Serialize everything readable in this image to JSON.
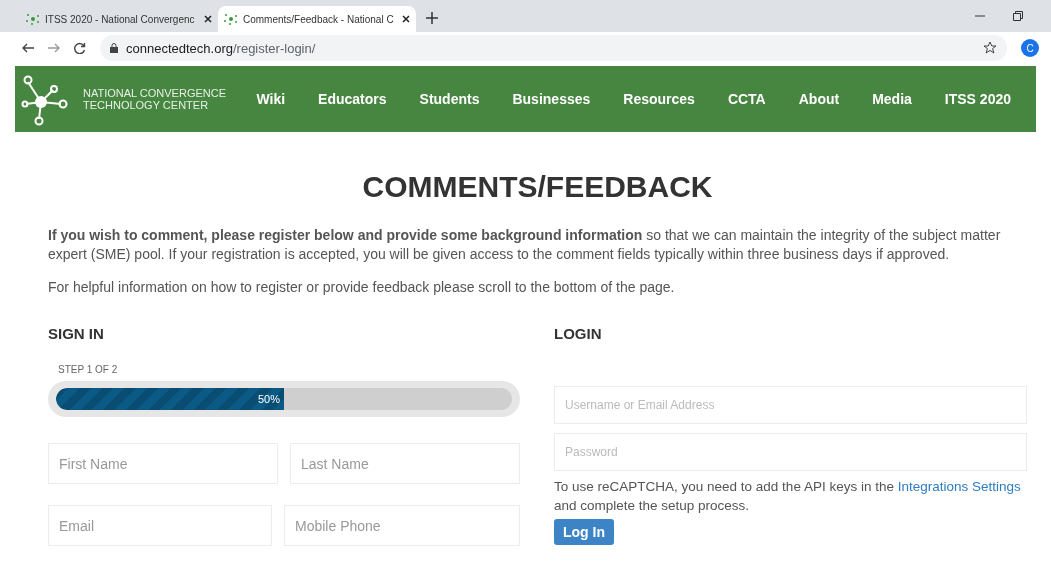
{
  "browser": {
    "tabs": [
      {
        "title": "ITSS 2020 - National Convergenc",
        "selected": false
      },
      {
        "title": "Comments/Feedback - National C",
        "selected": true
      }
    ],
    "url": {
      "host": "connectedtech.org",
      "path": "/register-login/"
    },
    "profile": "C"
  },
  "nav": {
    "brand": [
      "NATIONAL CONVERGENCE",
      "TECHNOLOGY CENTER"
    ],
    "items": [
      "Wiki",
      "Educators",
      "Students",
      "Businesses",
      "Resources",
      "CCTA",
      "About",
      "Media",
      "ITSS 2020"
    ]
  },
  "page": {
    "title": "COMMENTS/FEEDBACK",
    "intro": "**If you wish to comment, please register below and provide some background information** so that we can maintain the integrity of the subject matter expert (SME) pool. If your registration is accepted, you will be given access to the comment fields typically within three business days if approved.",
    "help": "For helpful information on how to register or provide feedback please scroll to the bottom of the page."
  },
  "signin": {
    "heading": "SIGN IN",
    "step": "STEP 1 OF 2",
    "progress": {
      "level": 0.5,
      "label": "50%"
    },
    "fields": [
      {
        "placeholder": "First Name"
      },
      {
        "placeholder": "Last Name"
      },
      {
        "placeholder": "Email"
      },
      {
        "placeholder": "Mobile Phone"
      }
    ]
  },
  "login": {
    "heading": "LOGIN",
    "fields": [
      {
        "placeholder": "Username or Email Address"
      },
      {
        "placeholder": "Password"
      }
    ],
    "recaptcha": {
      "before": "To use reCAPTCHA, you need to add the API keys in the",
      "link": "Integrations Settings",
      "after": "and complete the setup process."
    },
    "button": "Log In"
  }
}
